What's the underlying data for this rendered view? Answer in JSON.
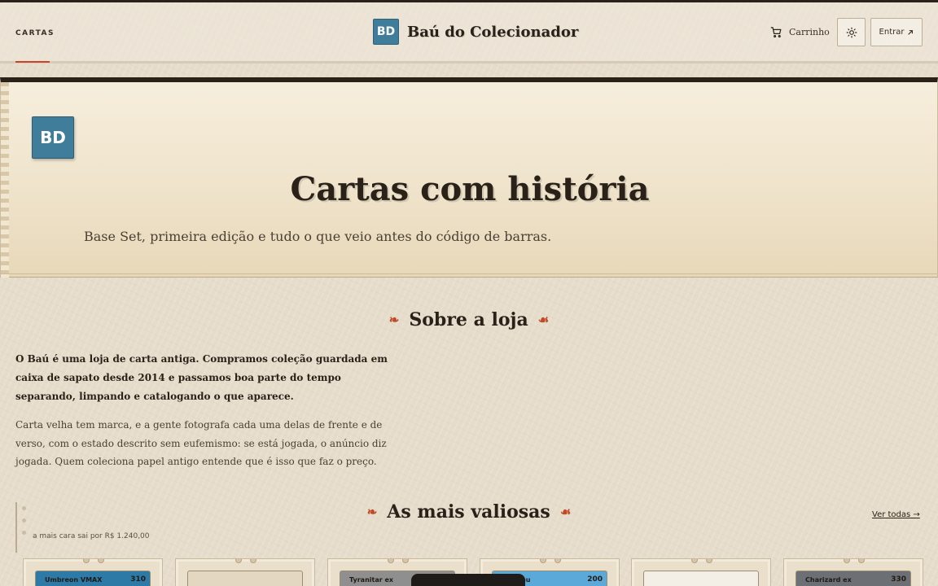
{
  "header": {
    "nav_label": "CARTAS",
    "brand_logo": "BD",
    "brand_title": "Baú do Colecionador",
    "cart_label": "Carrinho",
    "login_label": "Entrar",
    "accent_color": "#c8452c"
  },
  "hero": {
    "logo": "BD",
    "title": "Cartas com história",
    "subtitle": "Base Set, primeira edição e tudo o que veio antes do código de barras."
  },
  "about": {
    "heading": "Sobre a loja",
    "bold_text": "O Baú é uma loja de carta antiga. Compramos coleção guardada em caixa de sapato desde 2014 e passamos boa parte do tempo separando, limpando e catalogando o que aparece.",
    "text": "Carta velha tem marca, e a gente fotografa cada uma delas de frente e de verso, com o estado descrito sem eufemismo: se está jogada, o anúncio diz jogada. Quem coleciona papel antigo entende que é isso que faz o preço."
  },
  "valuable": {
    "heading": "As mais valiosas",
    "note": "a mais cara sai por R$ 1.240,00",
    "see_all": "Ver todas →",
    "cards": [
      {
        "name": "Umbreon VMAX",
        "hp": "310",
        "color": "#2e7aa6"
      },
      {
        "name": "",
        "hp": "",
        "color": "#e3d7c2"
      },
      {
        "name": "Tyranitar ex",
        "hp": "",
        "color": "#8f8f8f"
      },
      {
        "name": "Pikachu",
        "hp": "200",
        "color": "#5aa9d9"
      },
      {
        "name": "",
        "hp": "",
        "color": "#f3efe7"
      },
      {
        "name": "Charizard ex",
        "hp": "330",
        "color": "#6c6f74"
      }
    ]
  }
}
